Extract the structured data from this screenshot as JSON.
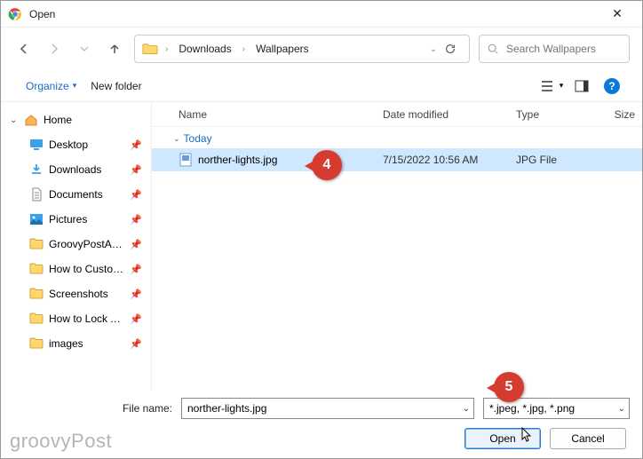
{
  "window": {
    "title": "Open"
  },
  "breadcrumb": {
    "seg1": "Downloads",
    "seg2": "Wallpapers"
  },
  "search": {
    "placeholder": "Search Wallpapers"
  },
  "toolbar": {
    "organize": "Organize",
    "newfolder": "New folder"
  },
  "sidebar": {
    "home": "Home",
    "items": [
      {
        "label": "Desktop"
      },
      {
        "label": "Downloads"
      },
      {
        "label": "Documents"
      },
      {
        "label": "Pictures"
      },
      {
        "label": "GroovyPostArticles"
      },
      {
        "label": "How to Customize"
      },
      {
        "label": "Screenshots"
      },
      {
        "label": "How to Lock Apps"
      },
      {
        "label": "images"
      }
    ]
  },
  "columns": {
    "name": "Name",
    "date": "Date modified",
    "type": "Type",
    "size": "Size"
  },
  "group": {
    "label": "Today"
  },
  "file": {
    "name": "norther-lights.jpg",
    "date": "7/15/2022 10:56 AM",
    "type": "JPG File"
  },
  "footer": {
    "filename_label": "File name:",
    "filename_value": "norther-lights.jpg",
    "filter": "*.jpeg, *.jpg, *.png",
    "open": "Open",
    "cancel": "Cancel"
  },
  "callouts": {
    "c4": "4",
    "c5": "5"
  },
  "watermark": "groovyPost"
}
